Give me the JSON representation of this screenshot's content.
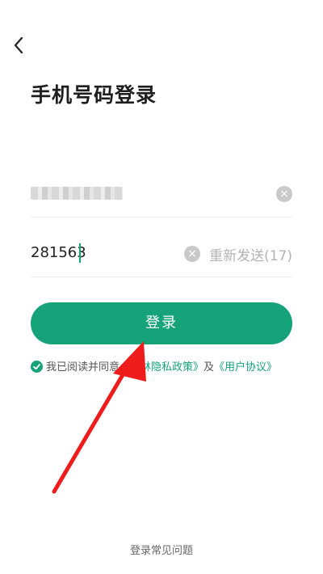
{
  "header": {
    "back_icon": "chevron-left-icon"
  },
  "title": "手机号码登录",
  "phone": {
    "value_masked": true,
    "clear_icon": "clear-icon"
  },
  "code": {
    "value": "281563",
    "resend_label": "重新发送(17)",
    "clear_icon": "clear-icon"
  },
  "login_button": {
    "label": "登录"
  },
  "agreement": {
    "prefix": "我已阅读并同意",
    "policy_link": "《参林隐私政策》",
    "conjunction": "及",
    "terms_link": "《用户协议》"
  },
  "footer": {
    "faq_label": "登录常见问题"
  },
  "colors": {
    "accent": "#16a37a",
    "annotation_arrow": "#ee1c1c"
  }
}
